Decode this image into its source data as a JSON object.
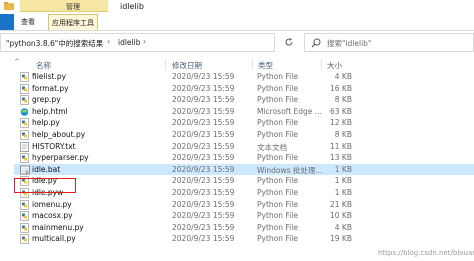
{
  "window": {
    "title": "idlelib",
    "context_group": "管理"
  },
  "ribbon": {
    "tabs": [
      {
        "label": ""
      },
      {
        "label": "查看"
      },
      {
        "label": "应用程序工具"
      }
    ]
  },
  "address_bar": {
    "crumbs": [
      "\"python3.8.6\"中的搜索结果",
      "idlelib"
    ]
  },
  "search": {
    "placeholder": "搜索\"idlelib\""
  },
  "columns": {
    "name": "名称",
    "date": "修改日期",
    "type": "类型",
    "size": "大小"
  },
  "files": [
    {
      "name": "filelist.py",
      "date": "2020/9/23 15:59",
      "type": "Python File",
      "size": "4 KB",
      "icon": "python-file-icon"
    },
    {
      "name": "format.py",
      "date": "2020/9/23 15:59",
      "type": "Python File",
      "size": "16 KB",
      "icon": "python-file-icon"
    },
    {
      "name": "grep.py",
      "date": "2020/9/23 15:59",
      "type": "Python File",
      "size": "8 KB",
      "icon": "python-file-icon"
    },
    {
      "name": "help.html",
      "date": "2020/9/23 15:59",
      "type": "Microsoft Edge ...",
      "size": "63 KB",
      "icon": "edge-html-icon"
    },
    {
      "name": "help.py",
      "date": "2020/9/23 15:59",
      "type": "Python File",
      "size": "12 KB",
      "icon": "python-file-icon"
    },
    {
      "name": "help_about.py",
      "date": "2020/9/23 15:59",
      "type": "Python File",
      "size": "8 KB",
      "icon": "python-file-icon"
    },
    {
      "name": "HISTORY.txt",
      "date": "2020/9/23 15:59",
      "type": "文本文档",
      "size": "11 KB",
      "icon": "text-file-icon"
    },
    {
      "name": "hyperparser.py",
      "date": "2020/9/23 15:59",
      "type": "Python File",
      "size": "13 KB",
      "icon": "python-file-icon"
    },
    {
      "name": "idle.bat",
      "date": "2020/9/23 15:59",
      "type": "Windows 批处理...",
      "size": "1 KB",
      "icon": "batch-file-icon",
      "selected": true
    },
    {
      "name": "idle.py",
      "date": "2020/9/23 15:59",
      "type": "Python File",
      "size": "1 KB",
      "icon": "python-file-icon"
    },
    {
      "name": "idle.pyw",
      "date": "2020/9/23 15:59",
      "type": "Python File",
      "size": "1 KB",
      "icon": "python-file-icon"
    },
    {
      "name": "iomenu.py",
      "date": "2020/9/23 15:59",
      "type": "Python File",
      "size": "21 KB",
      "icon": "python-file-icon"
    },
    {
      "name": "macosx.py",
      "date": "2020/9/23 15:59",
      "type": "Python File",
      "size": "10 KB",
      "icon": "python-file-icon"
    },
    {
      "name": "mainmenu.py",
      "date": "2020/9/23 15:59",
      "type": "Python File",
      "size": "4 KB",
      "icon": "python-file-icon"
    },
    {
      "name": "multicall.py",
      "date": "2020/9/23 15:59",
      "type": "Python File",
      "size": "19 KB",
      "icon": "python-file-icon"
    }
  ],
  "watermark": "https://blog.csdn.net/blouane",
  "colors": {
    "accent": "#1a73c7",
    "selection": "#cce8ff",
    "highlight_border": "#e0201f",
    "manage_group": "#f5e7a3"
  }
}
